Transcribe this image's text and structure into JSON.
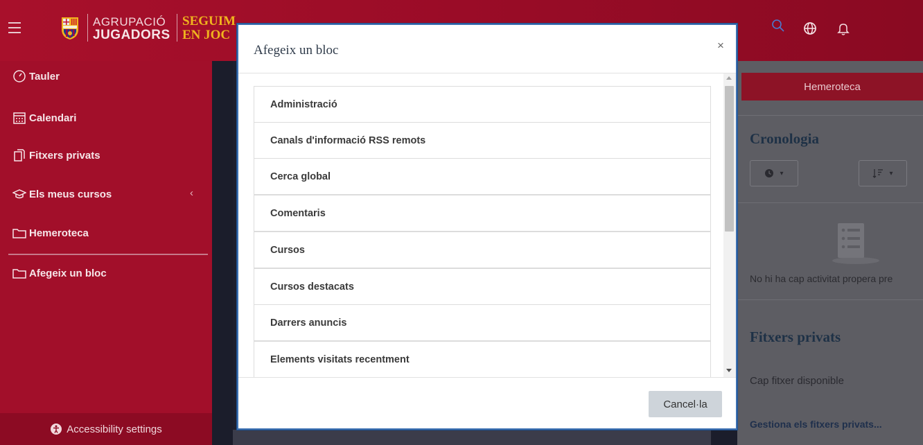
{
  "header": {
    "brand_line1": "AGRUPACIÓ",
    "brand_line2": "JUGADORS",
    "brand2_line1": "SEGUIM",
    "brand2_line2": "EN JOC",
    "icons": [
      "menu-icon",
      "fcb-crest-icon",
      "search-icon",
      "globe-icon",
      "bell-icon"
    ]
  },
  "sidebar": {
    "items": [
      {
        "label": "Tauler",
        "icon": "dashboard-icon"
      },
      {
        "label": "Calendari",
        "icon": "calendar-icon"
      },
      {
        "label": "Fitxers privats",
        "icon": "files-icon"
      },
      {
        "label": "Els meus cursos",
        "icon": "graduation-cap-icon"
      },
      {
        "label": "Hemeroteca",
        "icon": "folder-icon"
      },
      {
        "label": "Afegeix un bloc",
        "icon": "folder-icon"
      }
    ],
    "accessibility_label": "Accessibility settings"
  },
  "right": {
    "hemeroteca_button": "Hemeroteca",
    "cronologia_title": "Cronologia",
    "empty_text": "No hi ha cap activitat propera pre",
    "fitxers_title": "Fitxers privats",
    "no_files": "Cap fitxer disponible",
    "manage_link": "Gestiona els fitxers privats..."
  },
  "modal": {
    "title": "Afegeix un bloc",
    "close_label": "×",
    "blocks": [
      "Administració",
      "Canals d'informació RSS remots",
      "Cerca global",
      "Comentaris",
      "Cursos",
      "Cursos destacats",
      "Darrers anuncis",
      "Elements visitats recentment"
    ],
    "cancel_label": "Cancel·la"
  },
  "colors": {
    "header_red": "#a8102b",
    "sidebar_red": "#a20f2a",
    "gold": "#f0b41e",
    "modal_border": "#3c6fb0",
    "title_navy": "#1e3146"
  }
}
